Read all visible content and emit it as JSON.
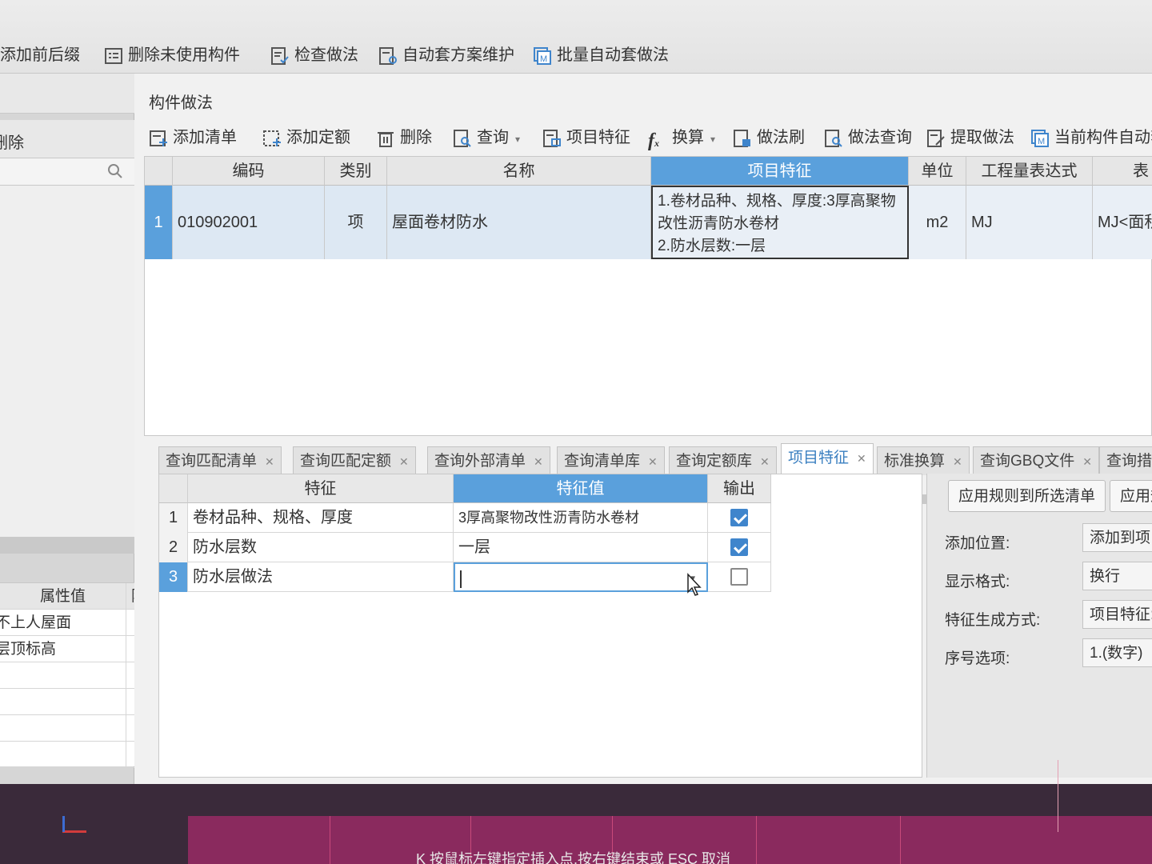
{
  "top_toolbar": {
    "items": [
      "添加前后缀",
      "删除未使用构件",
      "检查做法",
      "自动套方案维护",
      "批量自动套做法"
    ]
  },
  "left_panel": {
    "delete_label": "删除",
    "prop_header": {
      "value": "属性值",
      "extra": "附加"
    },
    "prop_rows": [
      {
        "value": "不上人屋面",
        "checked": null
      },
      {
        "value": "层顶标高",
        "checked": false
      },
      {
        "value": "",
        "checked": false
      },
      {
        "value": "",
        "checked": null
      },
      {
        "value": "",
        "checked": null
      },
      {
        "value": "",
        "checked": null
      }
    ]
  },
  "section": {
    "title": "构件做法"
  },
  "main_toolbar": {
    "items": [
      "添加清单",
      "添加定额",
      "删除",
      "查询",
      "项目特征",
      "换算",
      "做法刷",
      "做法查询",
      "提取做法",
      "当前构件自动套"
    ]
  },
  "grid": {
    "headers": [
      "编码",
      "类别",
      "名称",
      "项目特征",
      "单位",
      "工程量表达式",
      "表"
    ],
    "rows": [
      {
        "index": "1",
        "code": "010902001",
        "category": "项",
        "name": "屋面卷材防水",
        "feature": "1.卷材品种、规格、厚度:3厚高聚物改性沥青防水卷材\n2.防水层数:一层",
        "unit": "m2",
        "expression": "MJ",
        "expression_detail": "MJ<面积"
      }
    ]
  },
  "tabs": [
    {
      "label": "查询匹配清单",
      "active": false
    },
    {
      "label": "查询匹配定额",
      "active": false
    },
    {
      "label": "查询外部清单",
      "active": false
    },
    {
      "label": "查询清单库",
      "active": false
    },
    {
      "label": "查询定额库",
      "active": false
    },
    {
      "label": "项目特征",
      "active": true
    },
    {
      "label": "标准换算",
      "active": false
    },
    {
      "label": "查询GBQ文件",
      "active": false
    },
    {
      "label": "查询措",
      "active": false
    }
  ],
  "feature_table": {
    "headers": {
      "feature": "特征",
      "value": "特征值",
      "output": "输出"
    },
    "rows": [
      {
        "index": "1",
        "feature": "卷材品种、规格、厚度",
        "value": "3厚高聚物改性沥青防水卷材",
        "output": true
      },
      {
        "index": "2",
        "feature": "防水层数",
        "value": "一层",
        "output": true
      },
      {
        "index": "3",
        "feature": "防水层做法",
        "value": "",
        "output": false
      }
    ]
  },
  "options": {
    "apply_selected": "应用规则到所选清单",
    "apply_all": "应用规",
    "fields": [
      {
        "label": "添加位置:",
        "value": "添加到项目"
      },
      {
        "label": "显示格式:",
        "value": "换行"
      },
      {
        "label": "特征生成方式:",
        "value": "项目特征:"
      },
      {
        "label": "序号选项:",
        "value": "1.(数字)"
      }
    ]
  },
  "status_bar": {
    "text": "K 按鼠标左键指定插入点,按右键结束或 ESC 取消"
  },
  "colors": {
    "accent": "#5aa0dc",
    "checkbox": "#3f85cc",
    "cad_bg": "#8a2a5e"
  }
}
